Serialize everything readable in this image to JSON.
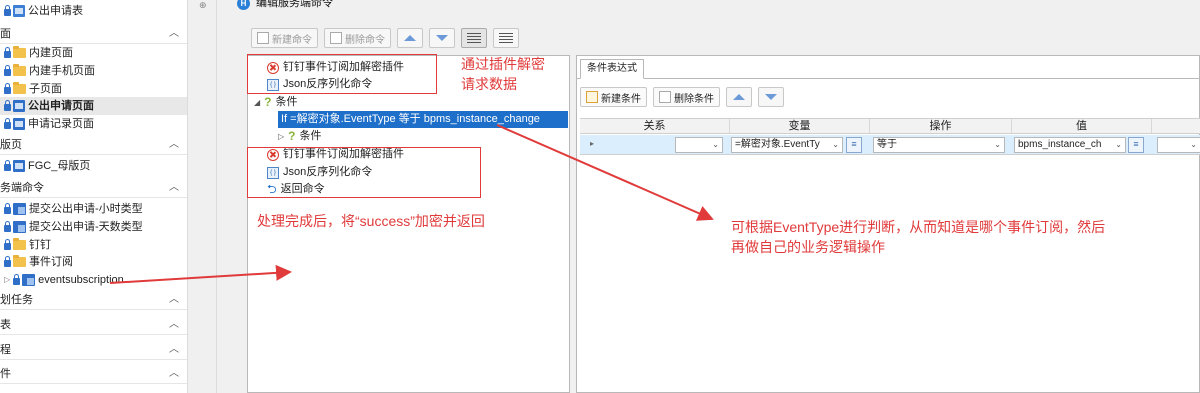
{
  "sidebar": {
    "items": [
      {
        "label": "公出申请表"
      },
      {
        "label": "内建页面"
      },
      {
        "label": "内建手机页面"
      },
      {
        "label": "子页面"
      },
      {
        "label": "公出申请页面"
      },
      {
        "label": "申请记录页面"
      },
      {
        "label": "FGC_母版页"
      },
      {
        "label": "提交公出申请-小时类型"
      },
      {
        "label": "提交公出申请-天数类型"
      },
      {
        "label": "钉钉"
      },
      {
        "label": "事件订阅"
      },
      {
        "label": "eventsubscription"
      }
    ],
    "sections": [
      {
        "label": "面"
      },
      {
        "label": "版页"
      },
      {
        "label": "务端命令"
      },
      {
        "label": "划任务"
      },
      {
        "label": "表"
      },
      {
        "label": "程"
      },
      {
        "label": "件"
      }
    ]
  },
  "dialog": {
    "title": "编辑服务端命令",
    "toolbar": {
      "new_cmd": "新建命令",
      "del_cmd": "删除命令"
    }
  },
  "commands": {
    "dingtalk_plugin_1": "钉钉事件订阅加解密插件",
    "json_1": "Json反序列化命令",
    "condition": "条件",
    "if_text": "If   =解密对象.EventType 等于 bpms_instance_change",
    "sub_condition": "条件",
    "dingtalk_plugin_2": "钉钉事件订阅加解密插件",
    "json_2": "Json反序列化命令",
    "return": "返回命令"
  },
  "annotations": {
    "top_line1": "通过插件解密",
    "top_line2": "请求数据",
    "bottom": "处理完成后，将“success”加密并返回",
    "right_line1": "可根据EventType进行判断，从而知道是哪个事件订阅，然后",
    "right_line2": "再做自己的业务逻辑操作"
  },
  "condition_panel": {
    "tab": "条件表达式",
    "new_cond": "新建条件",
    "del_cond": "删除条件",
    "columns": [
      "关系",
      "变量",
      "操作",
      "值"
    ],
    "row": {
      "relation": "",
      "variable": "=解密对象.EventTy",
      "operator": "等于",
      "value": "bpms_instance_ch"
    }
  },
  "colors": {
    "annotation": "#e03a3a",
    "selected": "#1e6fc9",
    "grid_row": "#dbeefd"
  }
}
